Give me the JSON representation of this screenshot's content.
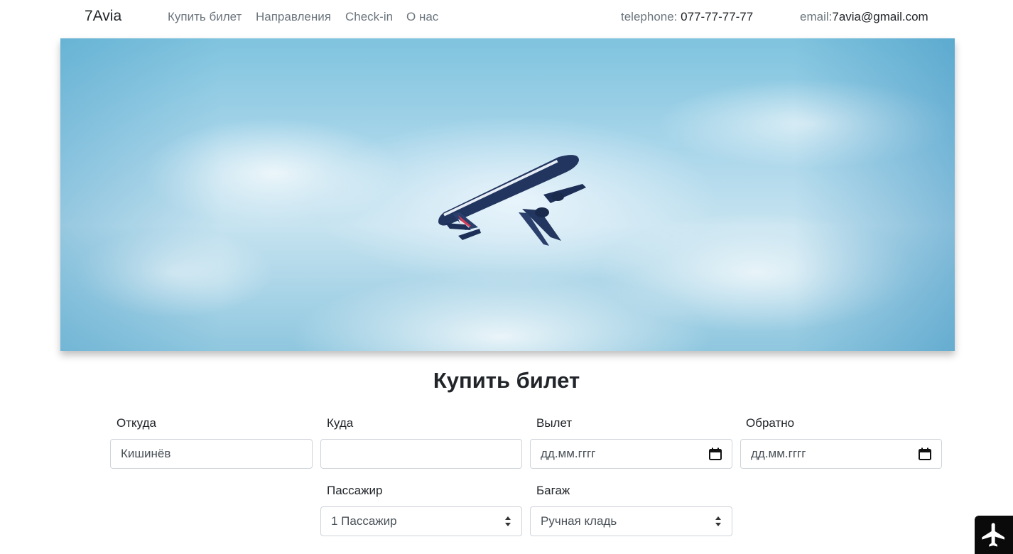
{
  "navbar": {
    "brand": "7Avia",
    "links": [
      "Купить билет",
      "Направления",
      "Check-in",
      "О нас"
    ],
    "phone_label": "telephone: ",
    "phone_value": "077-77-77-77",
    "email_label": "email:",
    "email_value": "7avia@gmail.com"
  },
  "hero": {
    "icon": "airplane-photo"
  },
  "form": {
    "title": "Купить билет",
    "from": {
      "label": "Откуда",
      "value": "Кишинёв"
    },
    "to": {
      "label": "Куда",
      "value": ""
    },
    "depart": {
      "label": "Вылет",
      "placeholder": "дд.мм.гггг"
    },
    "return": {
      "label": "Обратно",
      "placeholder": "дд.мм.гггг"
    },
    "passengers": {
      "label": "Пассажир",
      "selected": "1 Пассажир"
    },
    "baggage": {
      "label": "Багаж",
      "selected": "Ручная кладь"
    }
  },
  "fab": {
    "icon": "airplane-icon"
  },
  "colors": {
    "text": "#212529",
    "muted": "#6c757d",
    "border": "#ced4da",
    "fab_bg": "#0a0a0a"
  }
}
